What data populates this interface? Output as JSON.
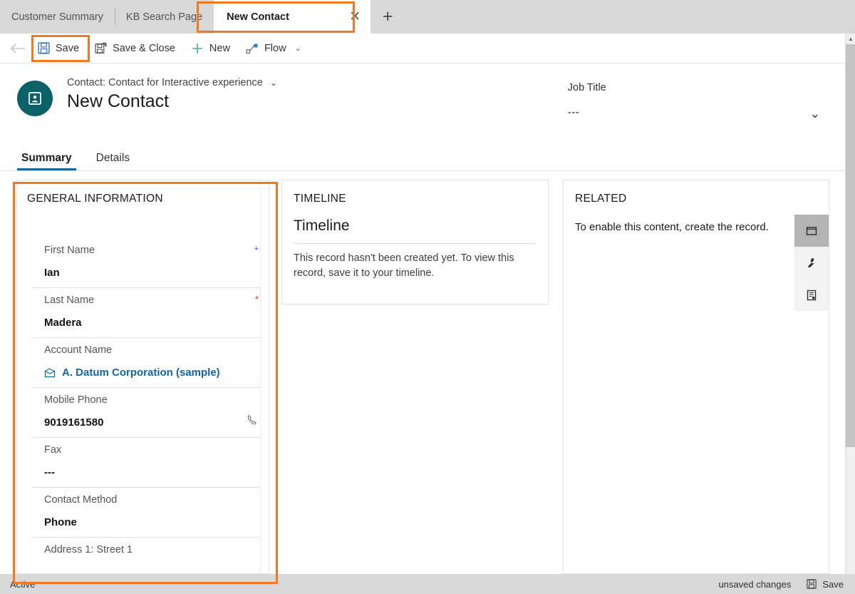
{
  "tabstrip": {
    "tabs": [
      {
        "label": "Customer Summary",
        "active": false
      },
      {
        "label": "KB Search Page",
        "active": false
      },
      {
        "label": "New Contact",
        "active": true
      }
    ],
    "close_glyph": "✕",
    "add_glyph": "+",
    "highlight_color": "#f07a21"
  },
  "commandbar": {
    "back_icon": "back-arrow-icon",
    "save_label": "Save",
    "save_close_label": "Save & Close",
    "new_label": "New",
    "flow_label": "Flow",
    "flow_chevron": "⌄"
  },
  "record_header": {
    "avatar_icon": "contact-card-icon",
    "avatar_color": "#0c6169",
    "entity_label": "Contact: Contact for Interactive experience",
    "entity_chevron": "⌄",
    "record_name": "New Contact",
    "job_title_label": "Job Title",
    "job_title_value": "---",
    "expand_chevron": "⌄"
  },
  "form_tabs": [
    {
      "label": "Summary",
      "active": true
    },
    {
      "label": "Details",
      "active": false
    }
  ],
  "general_information": {
    "title": "GENERAL INFORMATION",
    "fields": [
      {
        "label": "First Name",
        "value": "Ian",
        "marker": "plus",
        "icon": ""
      },
      {
        "label": "Last Name",
        "value": "Madera",
        "marker": "required",
        "icon": ""
      },
      {
        "label": "Account Name",
        "value": "A. Datum Corporation (sample)",
        "marker": "",
        "icon": "account-lookup-icon",
        "link": true
      },
      {
        "label": "Mobile Phone",
        "value": "9019161580",
        "marker": "",
        "icon": "phone-icon"
      },
      {
        "label": "Fax",
        "value": "---",
        "marker": "",
        "icon": ""
      },
      {
        "label": "Contact Method",
        "value": "Phone",
        "marker": "",
        "icon": ""
      },
      {
        "label": "Address 1: Street 1",
        "value": "",
        "marker": "",
        "icon": ""
      }
    ]
  },
  "timeline": {
    "title": "TIMELINE",
    "heading": "Timeline",
    "message": "This record hasn't been created yet.  To view this record, save it to your timeline."
  },
  "related": {
    "title": "RELATED",
    "message": "To enable this content, create the record.",
    "rail": [
      {
        "icon": "folder-icon",
        "active": true
      },
      {
        "icon": "wrench-icon",
        "active": false
      },
      {
        "icon": "document-icon",
        "active": false
      }
    ]
  },
  "statusbar": {
    "state": "Active",
    "unsaved_text": "unsaved changes",
    "save_label": "Save",
    "save_icon": "save-disk-icon"
  }
}
